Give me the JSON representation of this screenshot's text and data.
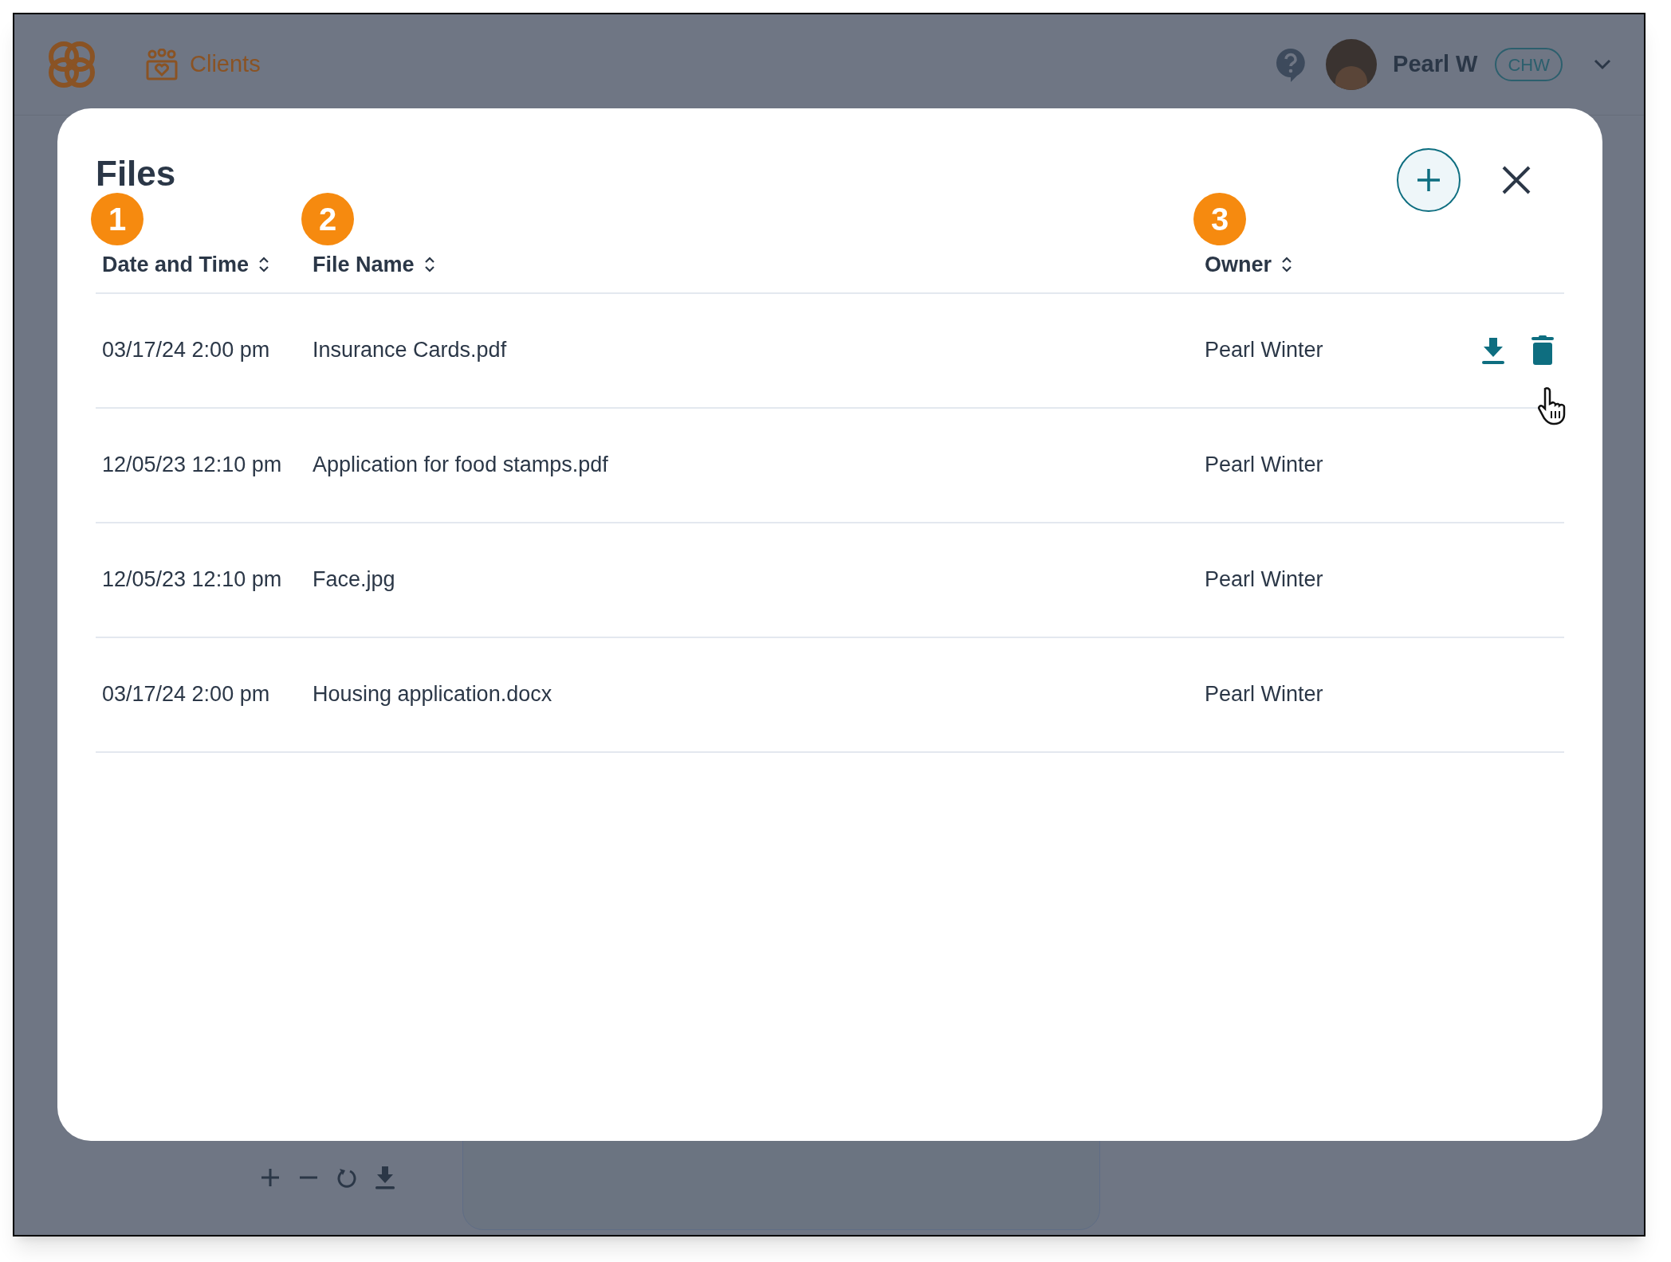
{
  "top_bar": {
    "nav_link": "Clients",
    "user_name": "Pearl W",
    "role_badge": "CHW"
  },
  "modal": {
    "title": "Files",
    "columns": [
      {
        "label": "Date and Time",
        "marker": "1"
      },
      {
        "label": "File Name",
        "marker": "2"
      },
      {
        "label": "Owner",
        "marker": "3"
      }
    ],
    "rows": [
      {
        "date_time": "03/17/24 2:00 pm",
        "file_name": "Insurance Cards.pdf",
        "owner": "Pearl Winter",
        "hovered": true
      },
      {
        "date_time": "12/05/23 12:10 pm",
        "file_name": "Application for food stamps.pdf",
        "owner": "Pearl Winter",
        "hovered": false
      },
      {
        "date_time": "12/05/23 12:10 pm",
        "file_name": "Face.jpg",
        "owner": "Pearl Winter",
        "hovered": false
      },
      {
        "date_time": "03/17/24 2:00 pm",
        "file_name": "Housing application.docx",
        "owner": "Pearl Winter",
        "hovered": false
      }
    ]
  }
}
